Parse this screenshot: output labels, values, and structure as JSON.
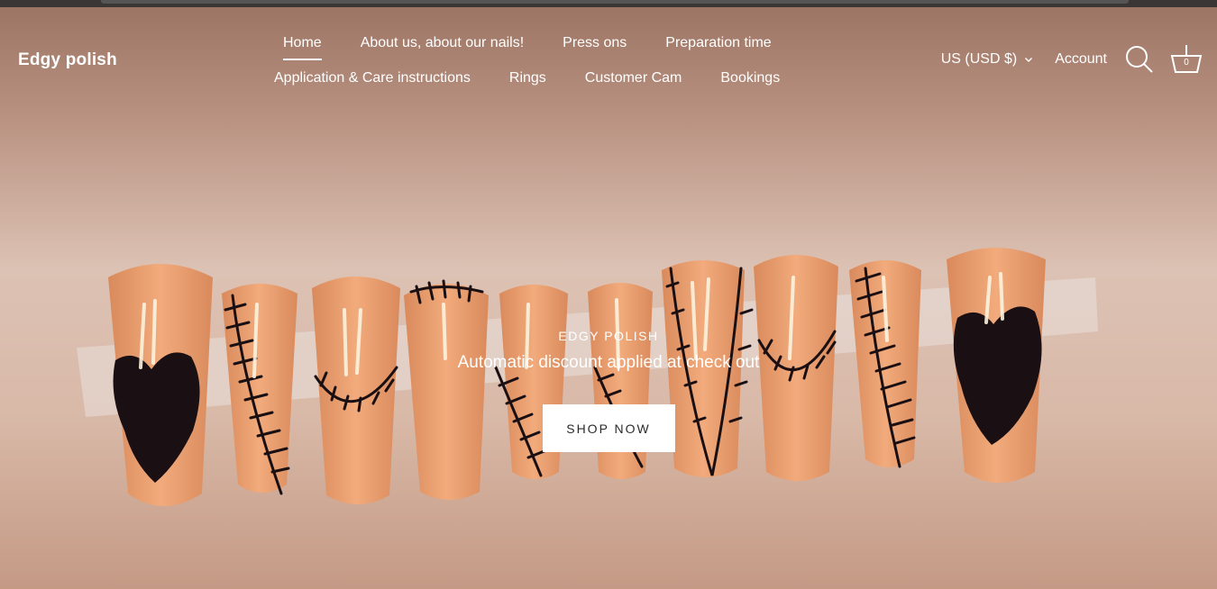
{
  "brand": {
    "name": "Edgy polish"
  },
  "nav": {
    "row1": [
      {
        "label": "Home",
        "active": true
      },
      {
        "label": "About us, about our nails!"
      },
      {
        "label": "Press ons"
      },
      {
        "label": "Preparation time"
      }
    ],
    "row2": [
      {
        "label": "Application & Care instructions"
      },
      {
        "label": "Rings"
      },
      {
        "label": "Customer Cam"
      },
      {
        "label": "Bookings"
      }
    ]
  },
  "header_right": {
    "currency": "US (USD $)",
    "account": "Account",
    "search_icon": "search-icon",
    "cart_icon": "basket-icon",
    "cart_count": "0"
  },
  "hero": {
    "eyebrow": "EDGY POLISH",
    "tagline": "Automatic discount applied at check out",
    "cta": "SHOP NOW"
  },
  "colors": {
    "nail_base": "#eea173",
    "nail_art": "#1a0f12",
    "white_text": "#ffffff"
  }
}
